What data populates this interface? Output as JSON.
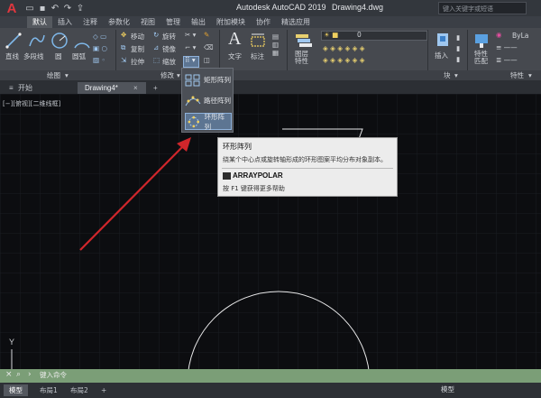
{
  "app": {
    "title": "Autodesk AutoCAD 2019",
    "file": "Drawing4.dwg",
    "search_placeholder": "键入关键字或短语",
    "accent": "#e0373e"
  },
  "ribbon_tabs": [
    "默认",
    "插入",
    "注释",
    "参数化",
    "视图",
    "管理",
    "输出",
    "附加模块",
    "协作",
    "精选应用"
  ],
  "ribbon": {
    "draw": {
      "line": "直线",
      "polyline": "多段线",
      "circle": "圆",
      "arc": "圆弧"
    },
    "modify": {
      "move": "移动",
      "rotate": "旋转",
      "copy": "复制",
      "mirror": "镜像",
      "stretch": "拉伸",
      "scale": "缩放"
    },
    "annotation": {
      "text": "文字",
      "dimension": "标注"
    },
    "layers": {
      "layer_properties": "图层\n特性",
      "layer_value": "0"
    },
    "block": {
      "insert": "插入"
    },
    "properties": {
      "match": "特性\n匹配",
      "bylayer": "ByLa"
    },
    "panel_titles": {
      "draw": "绘图",
      "modify": "修改",
      "block": "块",
      "properties": "特性"
    }
  },
  "doc_tabs": {
    "start": "开始",
    "drawing": "Drawing4*"
  },
  "viewport_label": "[−][俯视][二维线框]",
  "dropdown": {
    "items": [
      "矩形阵列",
      "路径阵列",
      "环形阵列"
    ]
  },
  "tooltip": {
    "title": "环形阵列",
    "description": "绕某个中心点或旋转轴形成的环形图案平均分布对象副本。",
    "command": "ARRAYPOLAR",
    "help": "按 F1 键获得更多帮助"
  },
  "command_line": {
    "placeholder": "键入命令"
  },
  "layout_tabs": [
    "模型",
    "布局1",
    "布局2"
  ],
  "status": {
    "model": "模型"
  },
  "coord": {
    "y_axis": "Y"
  }
}
